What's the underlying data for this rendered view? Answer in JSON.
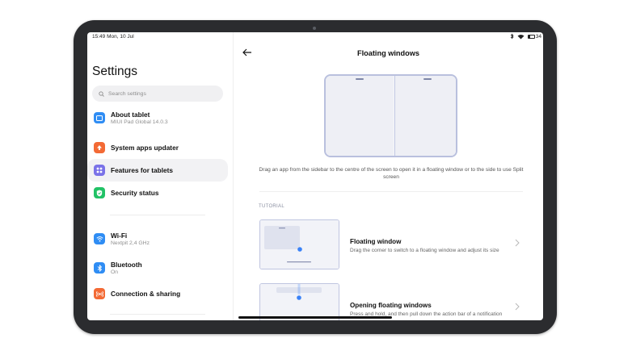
{
  "status_bar": {
    "time_date": "15:49 Mon, 10 Jul",
    "battery": "34",
    "battery_level": 0.34
  },
  "sidebar": {
    "title": "Settings",
    "search_placeholder": "Search settings",
    "items": [
      {
        "label": "About tablet",
        "sub": "MIUI Pad Global 14.0.3",
        "icon": "tablet-icon",
        "color": "#2f8df4"
      },
      {
        "label": "System apps updater",
        "sub": "",
        "icon": "arrow-up-icon",
        "color": "#f36a35"
      },
      {
        "label": "Features for tablets",
        "sub": "",
        "icon": "grid-icon",
        "color": "#7a72e8",
        "active": true
      },
      {
        "label": "Security status",
        "sub": "",
        "icon": "shield-check-icon",
        "color": "#21c266"
      },
      {
        "label": "Wi-Fi",
        "sub": "Nextpit 2,4 GHz",
        "icon": "wifi-icon",
        "color": "#2f8df4"
      },
      {
        "label": "Bluetooth",
        "sub": "On",
        "icon": "bluetooth-icon",
        "color": "#2f8df4"
      },
      {
        "label": "Connection & sharing",
        "sub": "",
        "icon": "connection-icon",
        "color": "#f36a35"
      }
    ]
  },
  "detail": {
    "title": "Floating windows",
    "description": "Drag an app from the sidebar to the centre of the screen to open it in a floating window or to the side to use Split screen",
    "section_label": "TUTORIAL",
    "tutorials": [
      {
        "title": "Floating window",
        "subtitle": "Drag the corner to switch to a floating window and adjust its size"
      },
      {
        "title": "Opening floating windows",
        "subtitle": "Press and hold, and then pull down the action bar of a notification"
      }
    ]
  },
  "colors": {
    "accent": "#3a82f7",
    "illustration_border": "#b9c0de"
  }
}
